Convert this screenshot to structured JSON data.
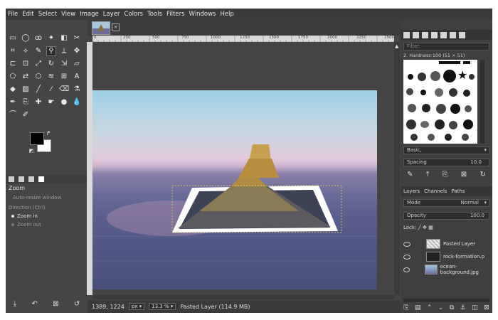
{
  "menu": [
    "File",
    "Edit",
    "Select",
    "View",
    "Image",
    "Layer",
    "Colors",
    "Tools",
    "Filters",
    "Windows",
    "Help"
  ],
  "tool_options": {
    "tabs": [
      "tool-options-icon",
      "device-status-icon",
      "undo-history-icon",
      "images-icon"
    ],
    "title": "Zoom",
    "auto_resize": "Auto-resize window",
    "direction_label": "Direction (Ctrl)",
    "zoom_in": "Zoom in",
    "zoom_out": "Zoom out"
  },
  "ruler": {
    "top_labels": [
      "0",
      "250",
      "500",
      "750",
      "1000",
      "1250",
      "1500",
      "1750",
      "2000",
      "2250",
      "2500"
    ]
  },
  "status": {
    "coords": "1389, 1224",
    "unit": "px",
    "zoom": "13.3 %",
    "message": "Pasted Layer (114.9 MB)"
  },
  "brushes": {
    "filter_placeholder": "Filter",
    "current": "2. Hardness 100 (51 × 51)",
    "preset": "Basic,",
    "spacing_label": "Spacing",
    "spacing_value": "10.0"
  },
  "layers": {
    "tabs": [
      "Layers",
      "Channels",
      "Paths"
    ],
    "mode_label": "Mode",
    "mode_value": "Normal",
    "opacity_label": "Opacity",
    "opacity_value": "100.0",
    "lock_label": "Lock:",
    "items": [
      {
        "name": "Pasted Layer"
      },
      {
        "name": "rock-formation.p"
      },
      {
        "name": "ocean-background.jpg"
      }
    ]
  },
  "colors": {
    "accent": "#454545",
    "fg": "#000000",
    "bg": "#ffffff",
    "menubar": "#3a3a3a"
  }
}
